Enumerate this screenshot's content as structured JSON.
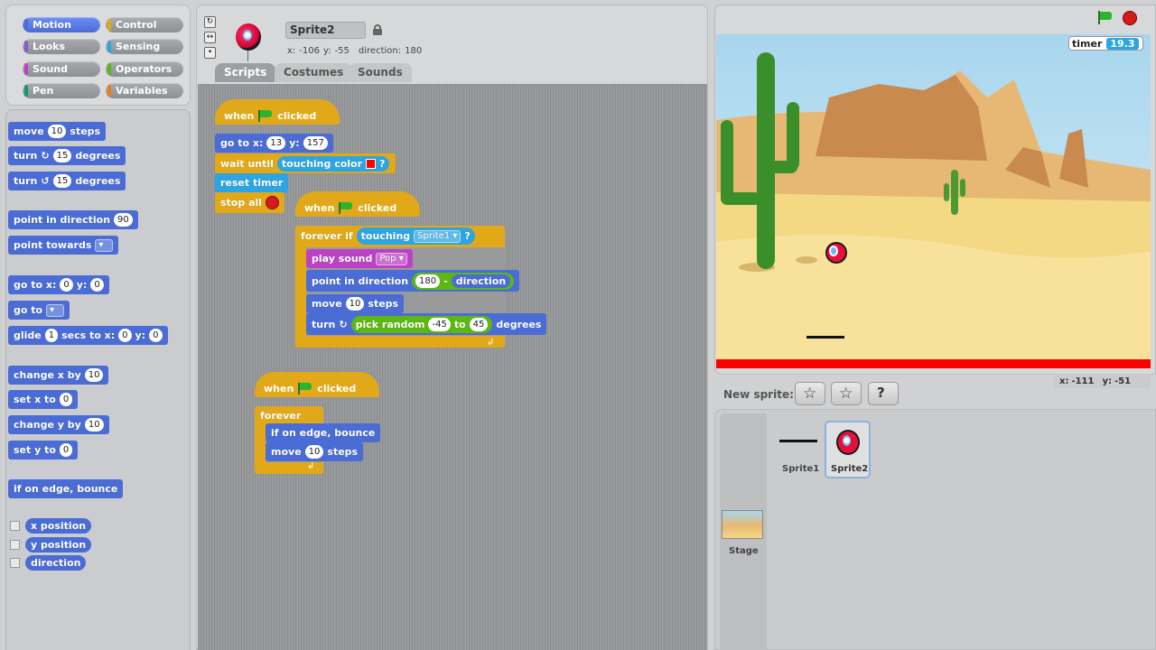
{
  "categories": [
    {
      "label": "Motion",
      "color": "#4a6cd4",
      "active": true
    },
    {
      "label": "Control",
      "color": "#e1a91a"
    },
    {
      "label": "Looks",
      "color": "#8a55d7"
    },
    {
      "label": "Sensing",
      "color": "#2ca5e2"
    },
    {
      "label": "Sound",
      "color": "#bb42c3"
    },
    {
      "label": "Operators",
      "color": "#5cb712"
    },
    {
      "label": "Pen",
      "color": "#0e9a6c"
    },
    {
      "label": "Variables",
      "color": "#ee7d16"
    }
  ],
  "palette": {
    "move": {
      "a": "move",
      "n": "10",
      "b": "steps"
    },
    "turn_cw": {
      "a": "turn",
      "n": "15",
      "b": "degrees"
    },
    "turn_ccw": {
      "a": "turn",
      "n": "15",
      "b": "degrees"
    },
    "point_dir": {
      "a": "point in direction",
      "n": "90"
    },
    "point_towards": {
      "a": "point towards"
    },
    "goto_xy": {
      "a": "go to x:",
      "x": "0",
      "b": "y:",
      "y": "0"
    },
    "goto": {
      "a": "go to"
    },
    "glide": {
      "a": "glide",
      "n": "1",
      "b": "secs to x:",
      "x": "0",
      "c": "y:",
      "y": "0"
    },
    "change_x": {
      "a": "change x by",
      "n": "10"
    },
    "set_x": {
      "a": "set x to",
      "n": "0"
    },
    "change_y": {
      "a": "change y by",
      "n": "10"
    },
    "set_y": {
      "a": "set y to",
      "n": "0"
    },
    "bounce": {
      "a": "if on edge, bounce"
    },
    "xpos": "x position",
    "ypos": "y position",
    "direction": "direction"
  },
  "sprite": {
    "name": "Sprite2",
    "x_label": "x:",
    "x": "-106",
    "y_label": "y:",
    "y": "-55",
    "direction_label": "direction:",
    "direction": "180"
  },
  "tabs": [
    "Scripts",
    "Costumes",
    "Sounds"
  ],
  "script1": {
    "hat_a": "when",
    "hat_b": "clicked",
    "goto_a": "go to x:",
    "goto_x": "13",
    "goto_b": "y:",
    "goto_y": "157",
    "wait_a": "wait until",
    "touching_color": "touching color",
    "q": "?",
    "reset": "reset timer",
    "stop": "stop all"
  },
  "script2": {
    "hat_a": "when",
    "hat_b": "clicked",
    "forever_if": "forever if",
    "touching": "touching",
    "touching_target": "Sprite1",
    "q": "?",
    "play": "play sound",
    "sound": "Pop",
    "point": "point in direction",
    "n180": "180",
    "minus": "-",
    "direction": "direction",
    "move_a": "move",
    "move_n": "10",
    "move_b": "steps",
    "turn_a": "turn",
    "pick": "pick random",
    "lo": "-45",
    "to": "to",
    "hi": "45",
    "degrees": "degrees"
  },
  "script3": {
    "hat_a": "when",
    "hat_b": "clicked",
    "forever": "forever",
    "bounce": "if on edge, bounce",
    "move_a": "move",
    "move_n": "10",
    "move_b": "steps"
  },
  "stage": {
    "timer_label": "timer",
    "timer_value": "19.3",
    "mouse_x_label": "x:",
    "mouse_x": "-111",
    "mouse_y_label": "y:",
    "mouse_y": "-51"
  },
  "sprites_panel": {
    "new_sprite": "New sprite:",
    "sprites": [
      "Sprite1",
      "Sprite2"
    ],
    "stage_label": "Stage"
  }
}
